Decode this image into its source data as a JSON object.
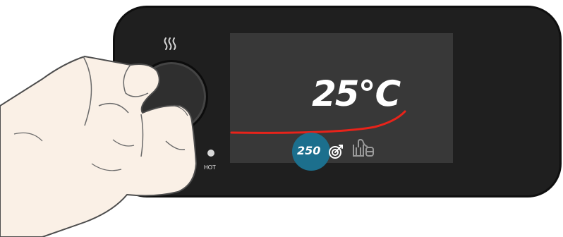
{
  "display": {
    "temperature": "25℃",
    "setpoint": "250"
  },
  "indicators": {
    "hot_label": "HOT"
  },
  "icons": {
    "heat": "heat-waves-icon",
    "target": "target-icon",
    "probe": "probe-icon"
  },
  "colors": {
    "panel": "#1f1f1f",
    "screen": "#383838",
    "accent_red": "#e8231a",
    "highlight": "#1c6f8d"
  }
}
